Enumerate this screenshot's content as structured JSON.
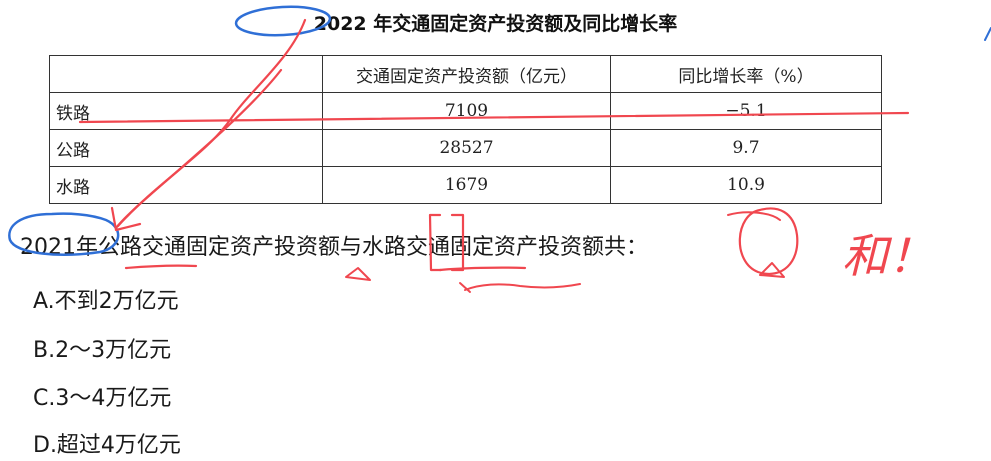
{
  "title": "2022 年交通固定资产投资额及同比增长率",
  "table": {
    "headers": [
      "",
      "交通固定资产投资额（亿元）",
      "同比增长率（%）"
    ],
    "rows": [
      {
        "name": "铁路",
        "amount": "7109",
        "growth": "−5.1"
      },
      {
        "name": "公路",
        "amount": "28527",
        "growth": "9.7"
      },
      {
        "name": "水路",
        "amount": "1679",
        "growth": "10.9"
      }
    ]
  },
  "question": "2021年公路交通固定资产投资额与水路交通固定资产投资额共：",
  "options": [
    {
      "label": "A.不到2万亿元"
    },
    {
      "label": "B.2～3万亿元"
    },
    {
      "label": "C.3～4万亿元"
    },
    {
      "label": "D.超过4万亿元"
    }
  ],
  "annotation": {
    "note": "和！"
  },
  "colors": {
    "red_ink": "#f0474f",
    "blue_ink": "#2f6fd6"
  }
}
